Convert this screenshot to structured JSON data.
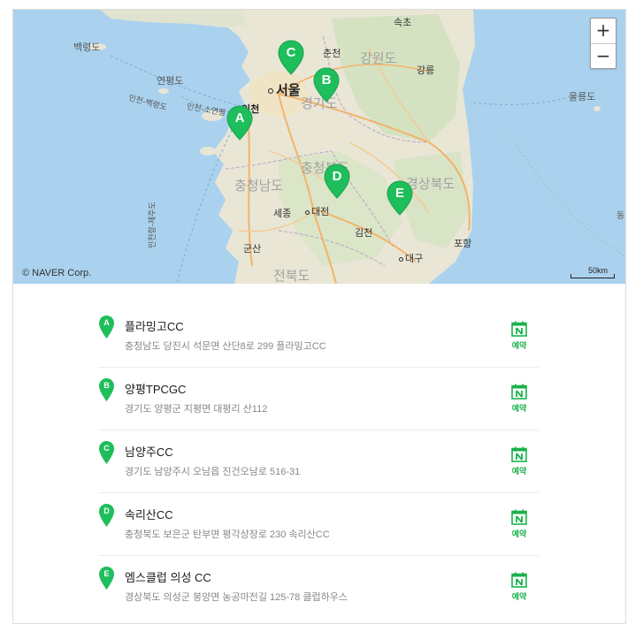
{
  "map": {
    "labels": {
      "sokcho": "속초",
      "baengnyeongdo": "백령도",
      "chuncheon": "춘천",
      "gangwondo": "강원도",
      "gangneung": "강릉",
      "yeonpyeongdo": "연평도",
      "seoul": "서울",
      "ulleungdo": "울릉도",
      "route_incheon_baengnyeong": "인천-백령도",
      "route_incheon_soyeonpyeong": "인천-소연평",
      "incheon": "인천",
      "gyeonggido": "경기도",
      "chungbuk": "충청북도",
      "gyeongbuk": "경상북도",
      "chungnam": "충청남도",
      "dokdo": "동",
      "sejong": "세종",
      "daejeon": "대전",
      "gimcheon": "김천",
      "pohang": "포항",
      "route_incheon_jeju": "인천항-제주도",
      "gunsan": "군산",
      "daegu": "대구",
      "jeonbuk": "전북도"
    },
    "copyright": "© NAVER Corp.",
    "scale_label": "50km",
    "zoom_in": "+",
    "zoom_out": "−",
    "marker_color": "#1fbe5c",
    "markers": [
      {
        "letter": "A"
      },
      {
        "letter": "B"
      },
      {
        "letter": "C"
      },
      {
        "letter": "D"
      },
      {
        "letter": "E"
      }
    ]
  },
  "booking_label": "예약",
  "booking_icon": "naver-booking-calendar-icon",
  "accent": "#19b24a",
  "places": [
    {
      "letter": "A",
      "name": "플라밍고CC",
      "address": "충청남도 당진시 석문면 산단8로 299 플라밍고CC"
    },
    {
      "letter": "B",
      "name": "양평TPCGC",
      "address": "경기도 양평군 지평면 대평리 산112"
    },
    {
      "letter": "C",
      "name": "남양주CC",
      "address": "경기도 남양주시 오남읍 진건오남로 516-31"
    },
    {
      "letter": "D",
      "name": "속리산CC",
      "address": "충청북도 보은군 탄부면 평각상장로 230 속리산CC"
    },
    {
      "letter": "E",
      "name": "엠스클럽 의성 CC",
      "address": "경상북도 의성군 봉양면 농공마전길 125-78 클럽하우스"
    }
  ]
}
